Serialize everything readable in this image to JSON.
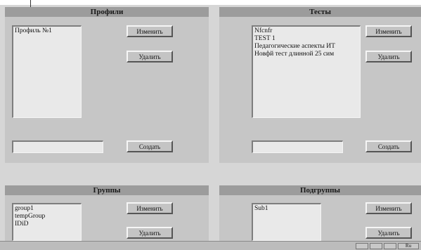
{
  "profiles": {
    "title": "Профили",
    "items": [
      "Профиль №1"
    ],
    "edit_label": "Изменить",
    "delete_label": "Удалить",
    "create_label": "Создать",
    "input_value": ""
  },
  "tests": {
    "title": "Тесты",
    "items": [
      "Nfcnfr",
      "TEST 1",
      "Педагогические аспекты ИТ",
      "Новфй тест длинной 25 сим"
    ],
    "edit_label": "Изменить",
    "delete_label": "Удалить",
    "create_label": "Создать",
    "input_value": ""
  },
  "groups": {
    "title": "Группы",
    "items": [
      "group1",
      "tempGroup",
      "IDiD"
    ],
    "edit_label": "Изменить",
    "delete_label": "Удалить"
  },
  "subgroups": {
    "title": "Подгруппы",
    "items": [
      "Sub1"
    ],
    "edit_label": "Изменить",
    "delete_label": "Удалить"
  },
  "statusbar": {
    "right_label": "Ru"
  }
}
